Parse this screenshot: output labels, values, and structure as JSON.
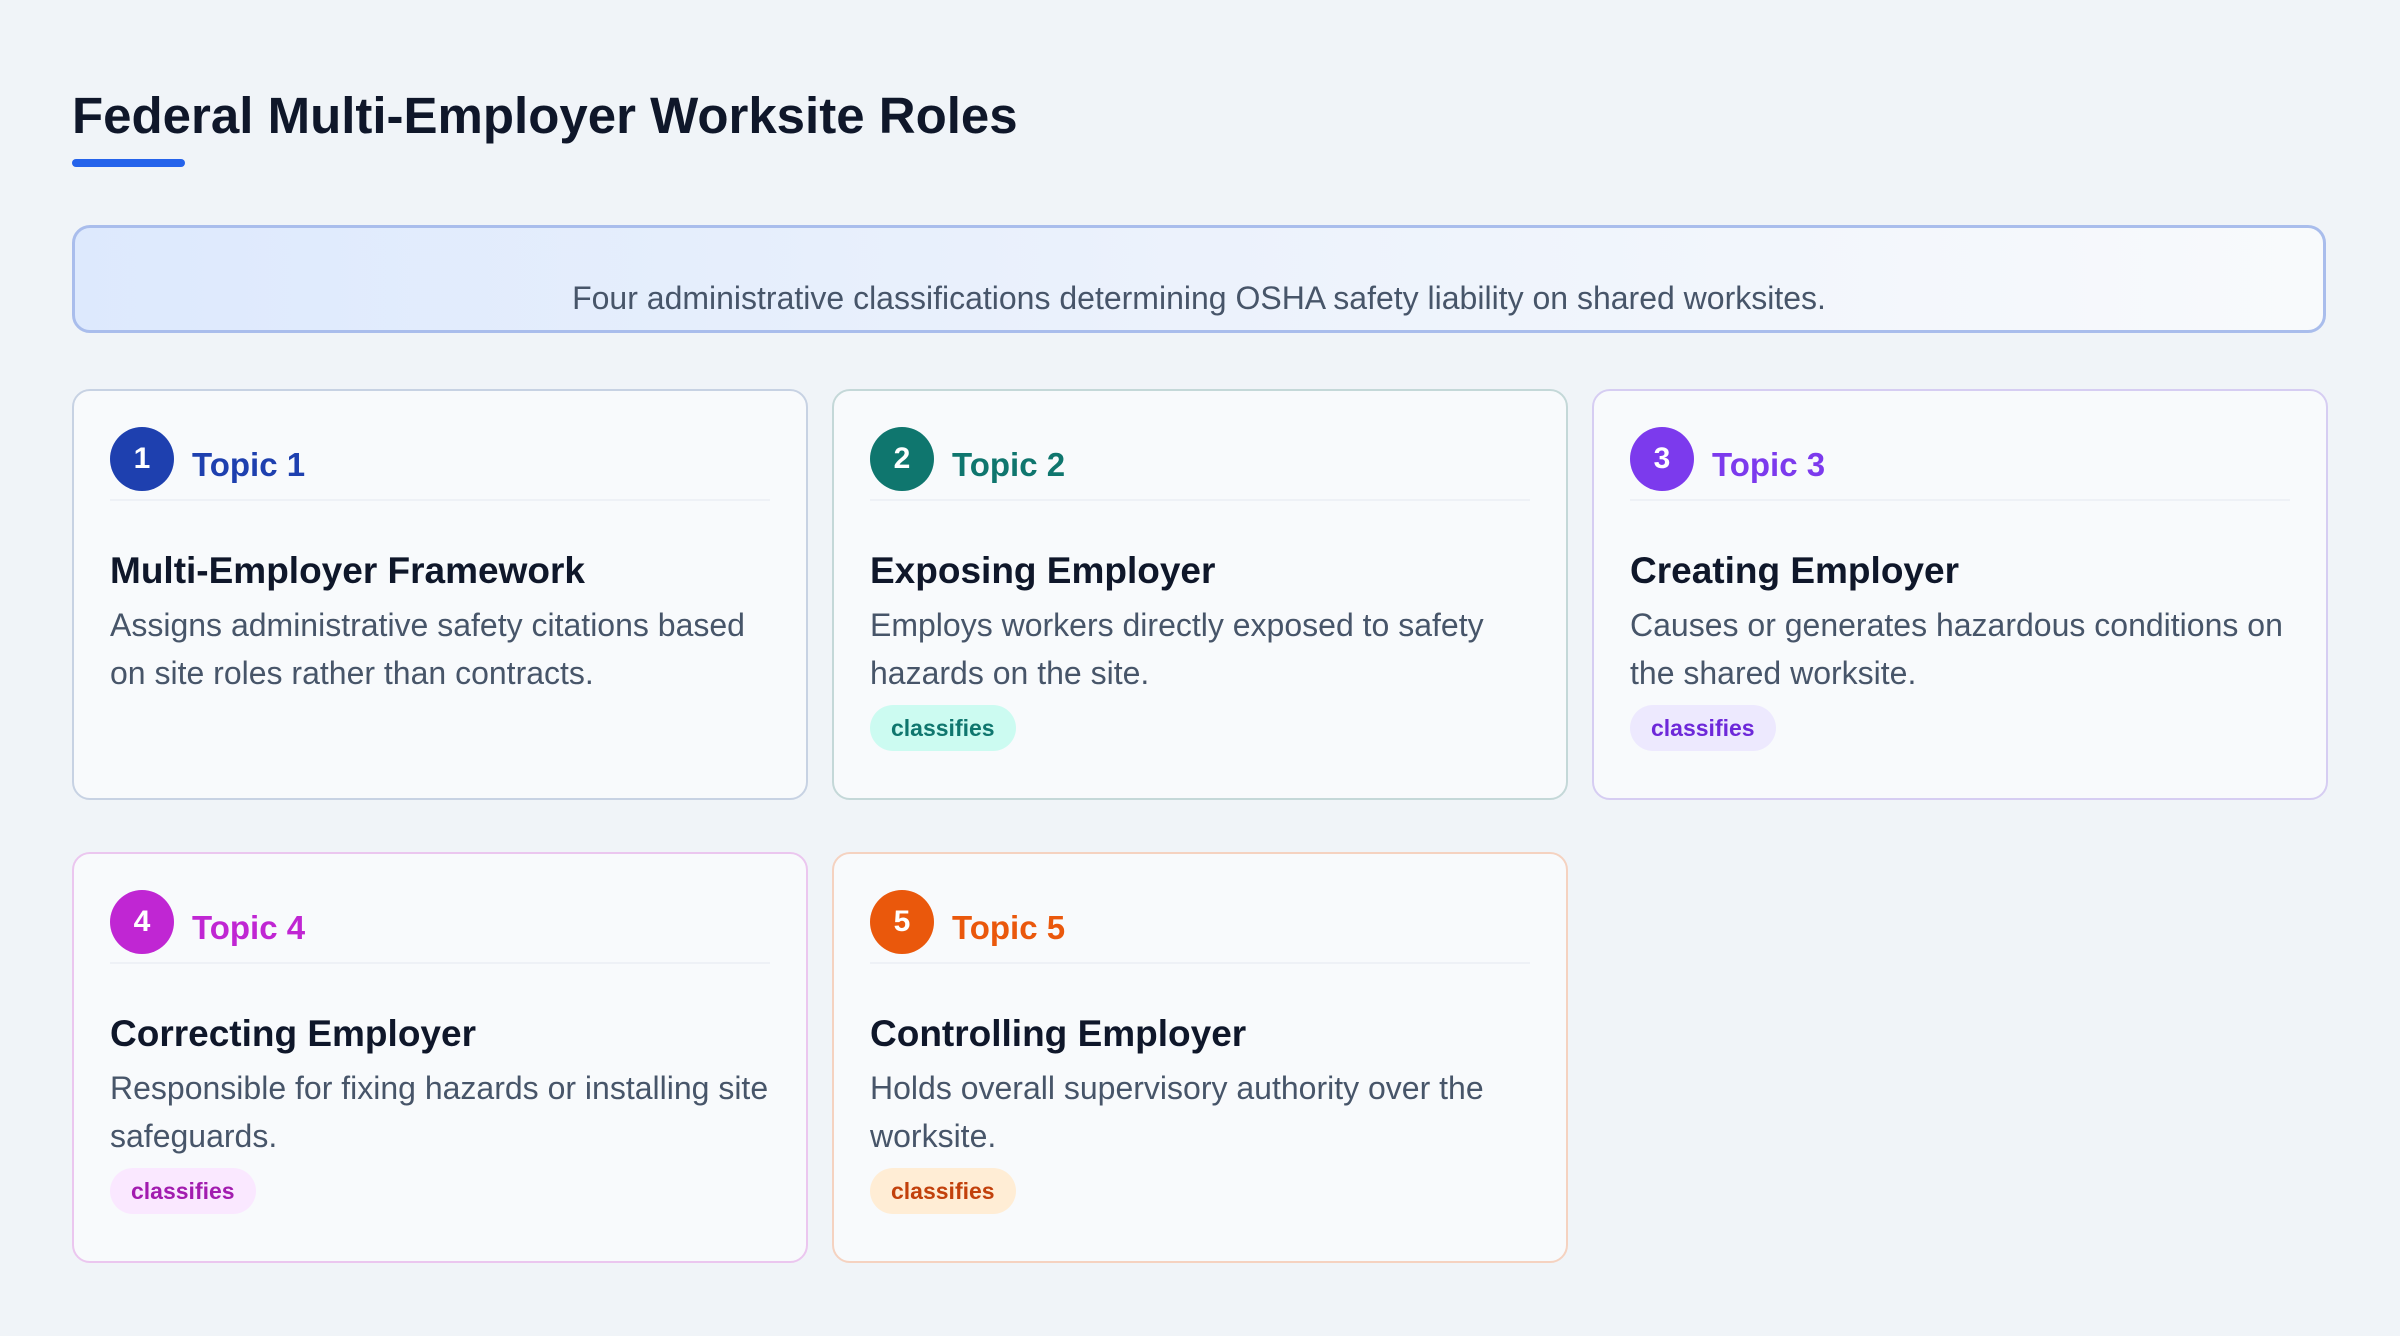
{
  "page": {
    "title": "Federal Multi-Employer Worksite Roles",
    "subtitle": "Four administrative classifications determining OSHA safety liability on shared worksites."
  },
  "cards": [
    {
      "number": "1",
      "topic": "Topic 1",
      "title": "Multi-Employer Framework",
      "description": "Assigns administrative safety citations based on site roles rather than contracts.",
      "tag": "",
      "colors": {
        "accent": "#1e40af",
        "border": "#c7d2e3",
        "tag_bg": "",
        "tag_text": ""
      }
    },
    {
      "number": "2",
      "topic": "Topic 2",
      "title": "Exposing Employer",
      "description": "Employs workers directly exposed to safety hazards on the site.",
      "tag": "classifies",
      "colors": {
        "accent": "#0f766e",
        "border": "#c4d8d8",
        "tag_bg": "#ccfbf1",
        "tag_text": "#0f766e"
      }
    },
    {
      "number": "3",
      "topic": "Topic 3",
      "title": "Creating Employer",
      "description": "Causes or generates hazardous conditions on the shared worksite.",
      "tag": "classifies",
      "colors": {
        "accent": "#7c3aed",
        "border": "#d6cdf2",
        "tag_bg": "#ede9fe",
        "tag_text": "#6d28d9"
      }
    },
    {
      "number": "4",
      "topic": "Topic 4",
      "title": "Correcting Employer",
      "description": "Responsible for fixing hazards or installing site safeguards.",
      "tag": "classifies",
      "colors": {
        "accent": "#c026d3",
        "border": "#ebc6ef",
        "tag_bg": "#fae8ff",
        "tag_text": "#a21caf"
      }
    },
    {
      "number": "5",
      "topic": "Topic 5",
      "title": "Controlling Employer",
      "description": "Holds overall supervisory authority over the worksite.",
      "tag": "classifies",
      "colors": {
        "accent": "#ea580c",
        "border": "#f5d2c0",
        "tag_bg": "#ffedd5",
        "tag_text": "#c2410c"
      }
    }
  ]
}
